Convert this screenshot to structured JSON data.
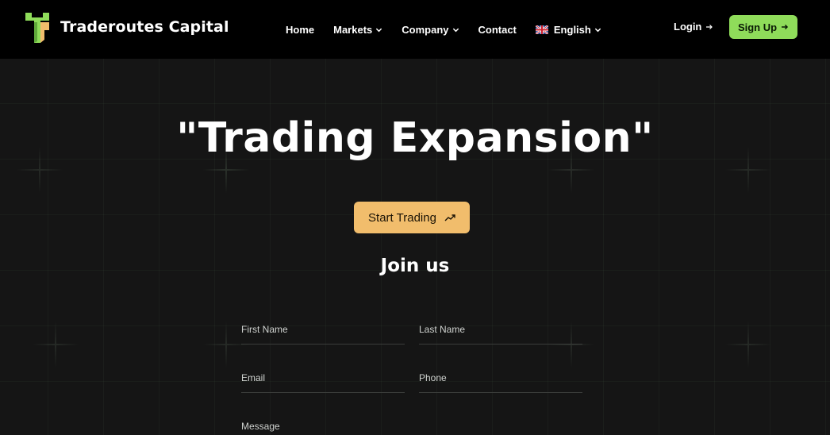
{
  "brand": {
    "name": "Traderoutes Capital",
    "logo_icon": "traderoutes-logo-icon"
  },
  "nav": {
    "home": "Home",
    "markets": "Markets",
    "company": "Company",
    "contact": "Contact",
    "language": "English"
  },
  "auth": {
    "login": "Login",
    "signup": "Sign Up"
  },
  "hero": {
    "title": "\"Trading Expansion\"",
    "cta": "Start Trading"
  },
  "form": {
    "title": "Join us",
    "first_name": "First Name",
    "last_name": "Last Name",
    "email": "Email",
    "phone": "Phone",
    "message": "Message"
  },
  "colors": {
    "accent_green": "#8fdc5a",
    "accent_orange": "#f1bd6c",
    "background": "#151515",
    "navbar": "#000000"
  }
}
